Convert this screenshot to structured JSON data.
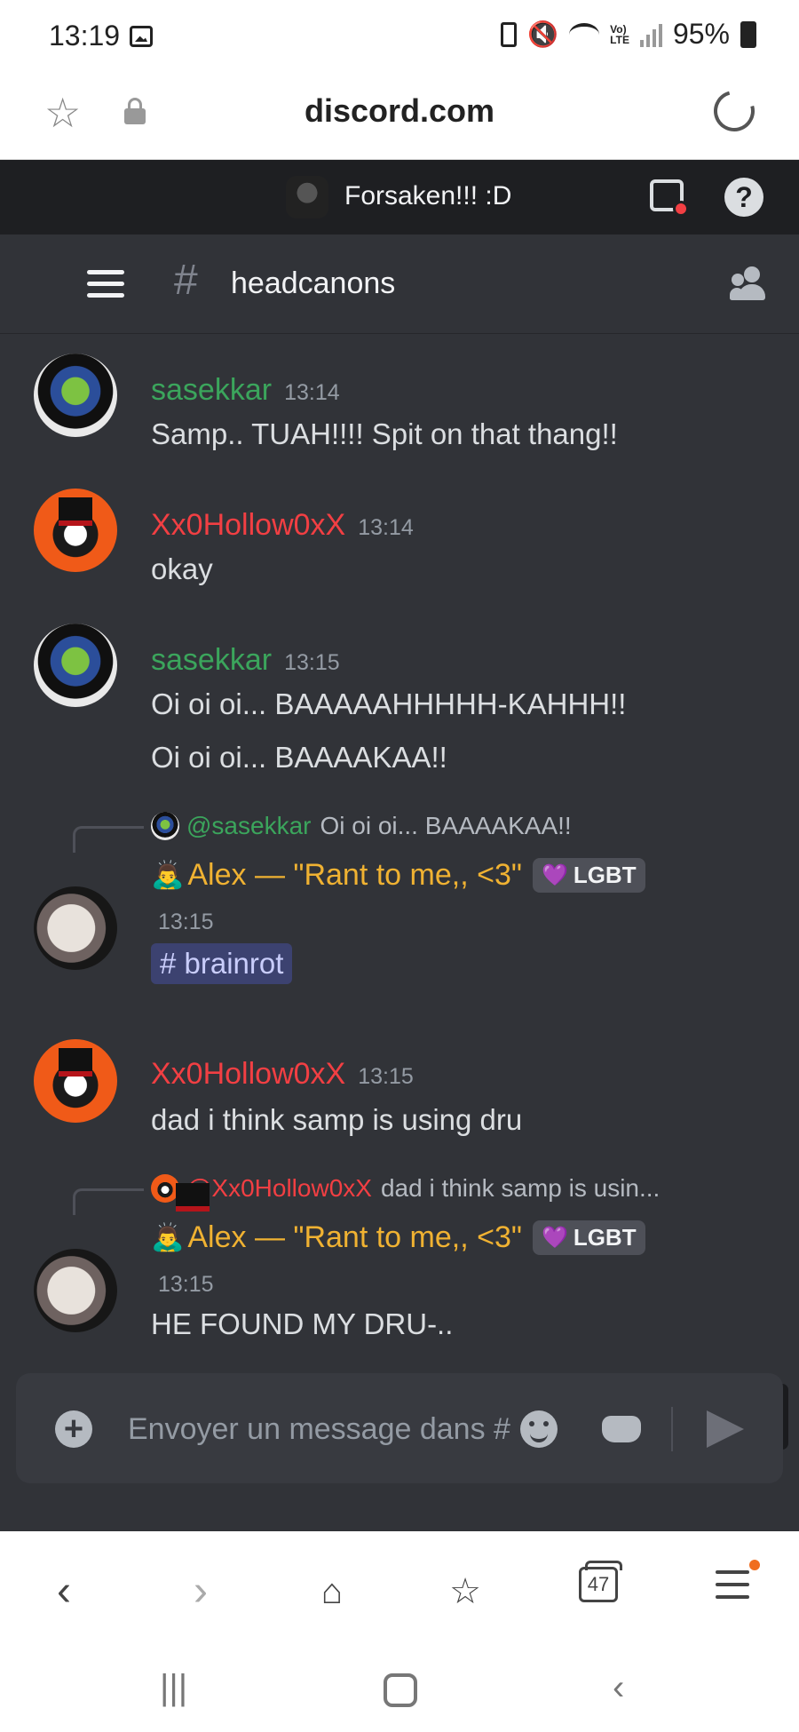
{
  "status": {
    "time": "13:19",
    "battery": "95%"
  },
  "browser": {
    "url": "discord.com",
    "tabs_count": "47"
  },
  "server": {
    "name": "Forsaken!!! :D"
  },
  "channel": {
    "hash": "#",
    "name": "headcanons"
  },
  "messages": [
    {
      "author": "sasekkar",
      "time": "13:14",
      "lines": [
        "Samp.. TUAH!!!! Spit on that thang!!"
      ]
    },
    {
      "author": "Xx0Hollow0xX",
      "time": "13:14",
      "lines": [
        "okay"
      ]
    },
    {
      "author": "sasekkar",
      "time": "13:15",
      "lines": [
        "Oi oi oi... BAAAAAHHHHH-KAHHH!!",
        "Oi oi oi... BAAAAKAA!!"
      ]
    },
    {
      "reply_to": {
        "mention": "@sasekkar",
        "text": "Oi oi oi... BAAAAKAA!!"
      },
      "emoji": "🙇‍♂️",
      "author": "Alex — \"Rant to me,, <3\"",
      "tag": "LGBT",
      "time": "13:15",
      "channel_link": "# brainrot"
    },
    {
      "author": "Xx0Hollow0xX",
      "time": "13:15",
      "lines": [
        "dad i think samp is using dru"
      ]
    },
    {
      "reply_to": {
        "mention": "@Xx0Hollow0xX",
        "text": "dad i think samp is usin..."
      },
      "emoji": "🙇‍♂️",
      "author": "Alex — \"Rant to me,, <3\"",
      "tag": "LGBT",
      "time": "13:15",
      "lines": [
        "HE FOUND MY DRU-.."
      ]
    }
  ],
  "composer": {
    "placeholder": "Envoyer un message dans #"
  },
  "icons": {
    "tag_heart": "💜",
    "help": "?",
    "plus": "+"
  },
  "colors": {
    "discord_bg": "#313338",
    "sasekkar": "#3ba55c",
    "hollow": "#f23f43",
    "alex": "#f0b232"
  }
}
